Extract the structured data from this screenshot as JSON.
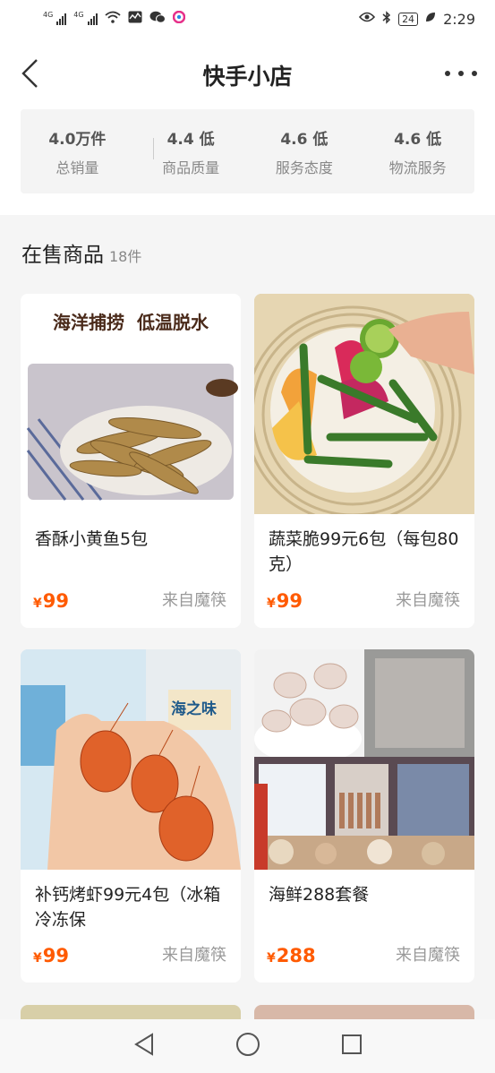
{
  "status_bar": {
    "network1": "4G",
    "network2": "4G",
    "battery": "24",
    "time": "2:29"
  },
  "header": {
    "title": "快手小店"
  },
  "stats": [
    {
      "value": "4.0万件",
      "label": "总销量"
    },
    {
      "value": "4.4 低",
      "label": "商品质量"
    },
    {
      "value": "4.6 低",
      "label": "服务态度"
    },
    {
      "value": "4.6 低",
      "label": "物流服务"
    }
  ],
  "section": {
    "title": "在售商品",
    "count": "18件"
  },
  "products": [
    {
      "name": "香酥小黄鱼5包",
      "currency": "¥",
      "price": "99",
      "source": "来自魔筷",
      "banner": "海洋捕捞  低温脱水"
    },
    {
      "name": "蔬菜脆99元6包（每包80克）",
      "currency": "¥",
      "price": "99",
      "source": "来自魔筷"
    },
    {
      "name": "补钙烤虾99元4包（冰箱冷冻保",
      "currency": "¥",
      "price": "99",
      "source": "来自魔筷",
      "package_text": "海之味"
    },
    {
      "name": "海鲜288套餐",
      "currency": "¥",
      "price": "288",
      "source": "来自魔筷"
    }
  ]
}
